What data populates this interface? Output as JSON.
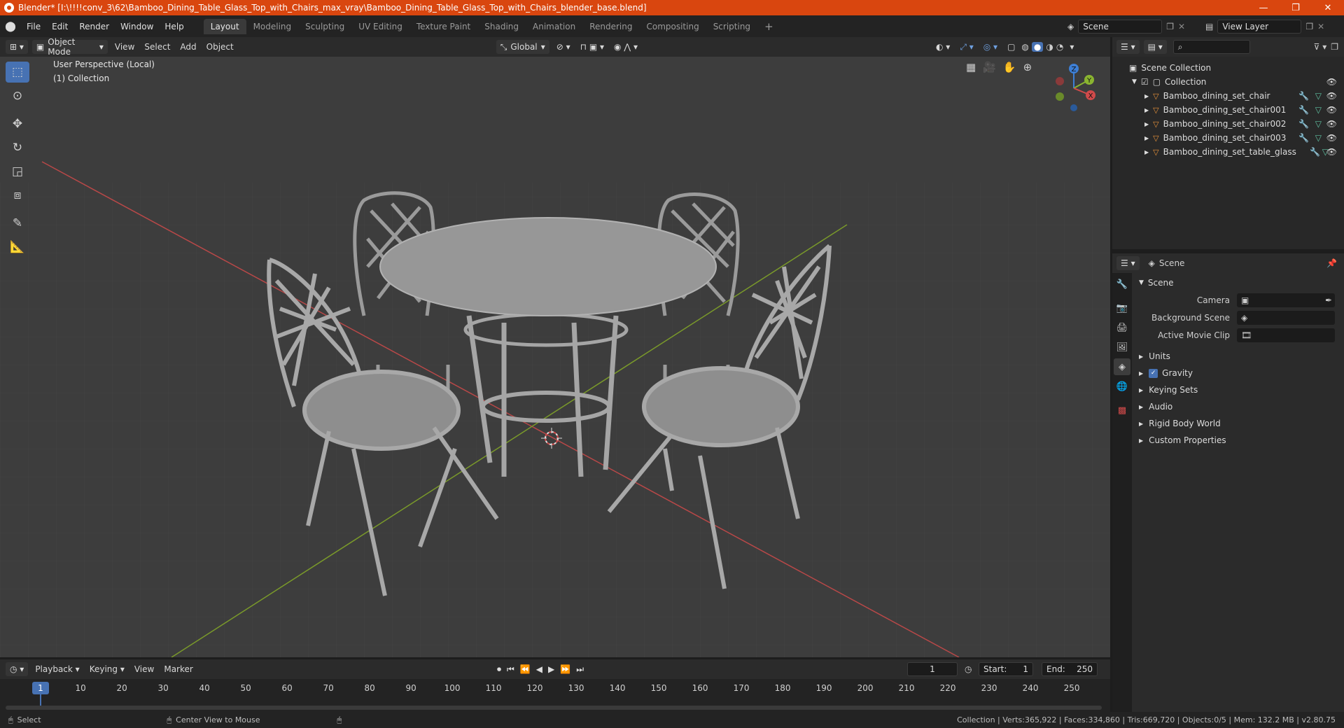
{
  "window": {
    "title": "Blender* [I:\\!!!!conv_3\\62\\Bamboo_Dining_Table_Glass_Top_with_Chairs_max_vray\\Bamboo_Dining_Table_Glass_Top_with_Chairs_blender_base.blend]",
    "minimize": "—",
    "restore": "❐",
    "close": "✕"
  },
  "menu": {
    "file": "File",
    "edit": "Edit",
    "render": "Render",
    "window": "Window",
    "help": "Help"
  },
  "workspaces": [
    "Layout",
    "Modeling",
    "Sculpting",
    "UV Editing",
    "Texture Paint",
    "Shading",
    "Animation",
    "Rendering",
    "Compositing",
    "Scripting"
  ],
  "workspace_add": "+",
  "scene_field": "Scene",
  "view_layer_field": "View Layer",
  "viewport_header": {
    "mode": "Object Mode",
    "view": "View",
    "select": "Select",
    "add": "Add",
    "object": "Object",
    "orientation": "Global"
  },
  "viewport": {
    "perspective": "User Perspective (Local)",
    "collection": "(1) Collection",
    "gizmo": {
      "z": "Z",
      "y": "Y",
      "x": "X"
    }
  },
  "outliner": {
    "scene_collection": "Scene Collection",
    "collection": "Collection",
    "objects": [
      "Bamboo_dining_set_chair",
      "Bamboo_dining_set_chair001",
      "Bamboo_dining_set_chair002",
      "Bamboo_dining_set_chair003",
      "Bamboo_dining_set_table_glass"
    ]
  },
  "properties": {
    "header": "Scene",
    "section": "Scene",
    "camera_label": "Camera",
    "background_label": "Background Scene",
    "movie_clip_label": "Active Movie Clip",
    "subsections": [
      "Units",
      "Gravity",
      "Keying Sets",
      "Audio",
      "Rigid Body World",
      "Custom Properties"
    ],
    "gravity_checked": true
  },
  "timeline": {
    "playback": "Playback",
    "keying": "Keying",
    "view": "View",
    "marker": "Marker",
    "current_frame": "1",
    "start_label": "Start:",
    "start": "1",
    "end_label": "End:",
    "end": "250",
    "ticks": [
      "1",
      "10",
      "20",
      "30",
      "40",
      "50",
      "60",
      "70",
      "80",
      "90",
      "100",
      "110",
      "120",
      "130",
      "140",
      "150",
      "160",
      "170",
      "180",
      "190",
      "200",
      "210",
      "220",
      "230",
      "240",
      "250"
    ]
  },
  "status": {
    "select": "Select",
    "center": "Center View to Mouse",
    "stats": "Collection | Verts:365,922 | Faces:334,860 | Tris:669,720 | Objects:0/5 | Mem: 132.2 MB | v2.80.75"
  },
  "colors": {
    "accent": "#4772b3",
    "titlebar": "#d9460f",
    "x_axis": "#d04a4a",
    "y_axis": "#8ab430",
    "z_axis": "#3d7fd6"
  }
}
